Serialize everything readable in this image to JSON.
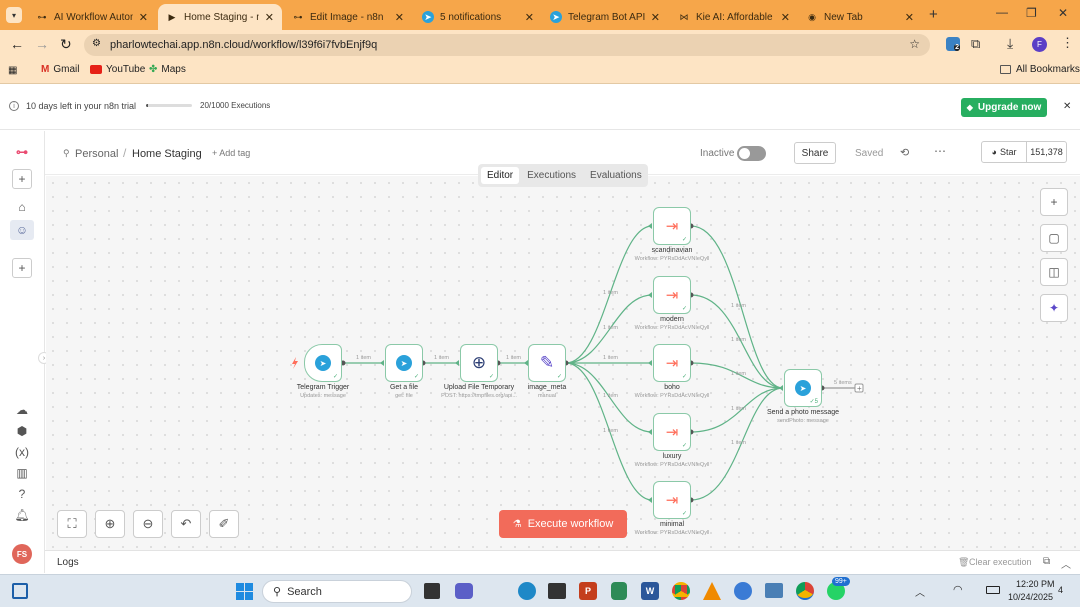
{
  "browser": {
    "tabs": [
      {
        "title": "AI Workflow Automa",
        "icon": "n8n-icon",
        "active": false
      },
      {
        "title": "Home Staging - n",
        "icon": "play-icon",
        "active": true
      },
      {
        "title": "Edit Image - n8n",
        "icon": "n8n-icon",
        "active": false
      },
      {
        "title": "5 notifications",
        "icon": "telegram-icon",
        "active": false
      },
      {
        "title": "Telegram Bot API",
        "icon": "telegram-icon",
        "active": false
      },
      {
        "title": "Kie AI: Affordable ar",
        "icon": "kie-icon",
        "active": false
      },
      {
        "title": "New Tab",
        "icon": "chrome-icon",
        "active": false
      }
    ],
    "url": "pharlowtechai.app.n8n.cloud/workflow/l39f6i7fvbEnjf9q",
    "bookmarks": [
      "Gmail",
      "YouTube",
      "Maps"
    ],
    "all_bookmarks": "All Bookmarks",
    "profile_initial": "F",
    "extension_badge": "2"
  },
  "trial": {
    "days_left": "10 days left in your n8n trial",
    "executions": "20/1000 Executions",
    "upgrade": "Upgrade now"
  },
  "header": {
    "scope": "Personal",
    "title": "Home Staging",
    "add_tag": "+ Add tag",
    "status": "Inactive",
    "share": "Share",
    "saved": "Saved",
    "star": "Star",
    "star_count": "151,378",
    "tabs": [
      "Editor",
      "Executions",
      "Evaluations"
    ]
  },
  "nodes": {
    "trigger": {
      "label": "Telegram Trigger",
      "sub": "Updates: message"
    },
    "getfile": {
      "label": "Get a file",
      "sub": "get: file"
    },
    "upload": {
      "label": "Upload File Temporary",
      "sub": "POST: https://tmpfiles.org/api..."
    },
    "meta": {
      "label": "image_meta",
      "sub": "manual"
    },
    "scandinavian": {
      "label": "scandinavian",
      "sub": "Workflow: PYRsDdAcVNIeQyll"
    },
    "modern": {
      "label": "modern",
      "sub": "Workflow: PYRsDdAcVNIeQyll"
    },
    "boho": {
      "label": "boho",
      "sub": "Workflow: PYRsDdAcVNIeQyll"
    },
    "luxury": {
      "label": "luxury",
      "sub": "Workflow: PYRsDdAcVNIeQyll"
    },
    "minimal": {
      "label": "minimal",
      "sub": "Workflow: PYRsDdAcVNIeQyll"
    },
    "send": {
      "label": "Send a photo message",
      "sub": "sendPhoto: message",
      "badge": "5"
    }
  },
  "edges": {
    "one_item": "1 item",
    "five_items": "5 items"
  },
  "execute": "Execute workflow",
  "logs": {
    "label": "Logs",
    "clear": "Clear execution"
  },
  "user_initials": "FS",
  "taskbar": {
    "search": "Search",
    "time": "12:20 PM",
    "date": "10/24/2025",
    "badge": "99+",
    "notif": "4"
  },
  "colors": {
    "accent": "#ff6d5a",
    "edge": "#4caf7a",
    "tab_bar": "#f6a64a",
    "green_btn": "#27ae60"
  }
}
